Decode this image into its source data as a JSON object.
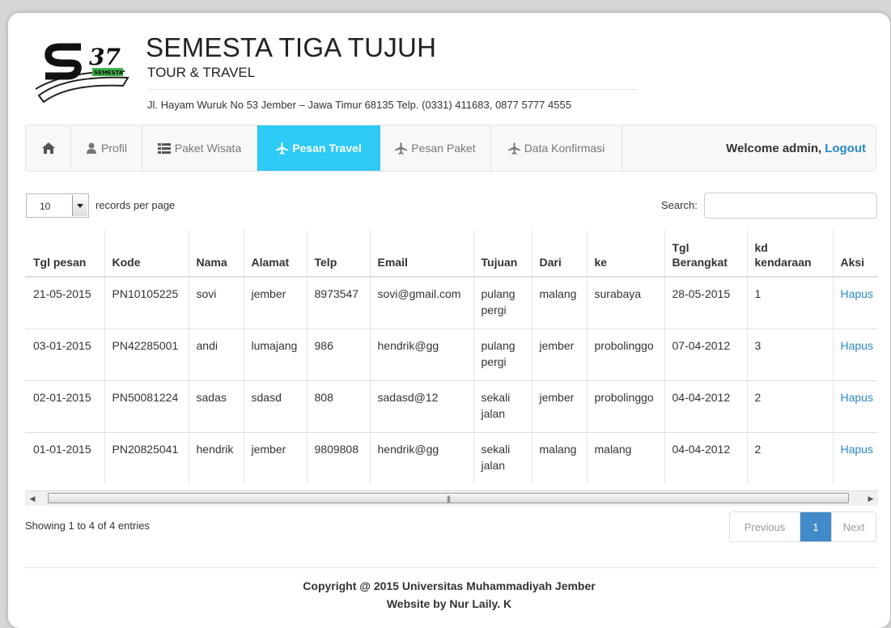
{
  "brand": {
    "title": "SEMESTA TIGA TUJUH",
    "subtitle": "TOUR & TRAVEL",
    "address": "Jl. Hayam Wuruk No 53 Jember – Jawa Timur 68135 Telp. (0331) 411683, 0877 5777 4555",
    "logo_text": "S37",
    "logo_small": "SEMESTA"
  },
  "nav": {
    "items": [
      {
        "label": "Profil",
        "icon": "user-icon"
      },
      {
        "label": "Paket Wisata",
        "icon": "list-icon"
      },
      {
        "label": "Pesan Travel",
        "icon": "plane-icon",
        "active": true
      },
      {
        "label": "Pesan Paket",
        "icon": "plane-icon"
      },
      {
        "label": "Data Konfirmasi",
        "icon": "plane-icon"
      }
    ],
    "welcome": "Welcome admin,",
    "logout": "Logout"
  },
  "controls": {
    "length_value": "10",
    "length_label": "records per page",
    "search_label": "Search:"
  },
  "table": {
    "headers": [
      "Tgl pesan",
      "Kode",
      "Nama",
      "Alamat",
      "Telp",
      "Email",
      "Tujuan",
      "Dari",
      "ke",
      "Tgl Berangkat",
      "kd kendaraan",
      "Aksi"
    ],
    "rows": [
      [
        "21-05-2015",
        "PN10105225",
        "sovi",
        "jember",
        "8973547",
        "sovi@gmail.com",
        "pulang pergi",
        "malang",
        "surabaya",
        "28-05-2015",
        "1",
        "Hapus"
      ],
      [
        "03-01-2015",
        "PN42285001",
        "andi",
        "lumajang",
        "986",
        "hendrik@gg",
        "pulang pergi",
        "jember",
        "probolinggo",
        "07-04-2012",
        "3",
        "Hapus"
      ],
      [
        "02-01-2015",
        "PN50081224",
        "sadas",
        "sdasd",
        "808",
        "sadasd@12",
        "sekali jalan",
        "jember",
        "probolinggo",
        "04-04-2012",
        "2",
        "Hapus"
      ],
      [
        "01-01-2015",
        "PN20825041",
        "hendrik",
        "jember",
        "9809808",
        "hendrik@gg",
        "sekali jalan",
        "malang",
        "malang",
        "04-04-2012",
        "2",
        "Hapus"
      ]
    ]
  },
  "info": "Showing 1 to 4 of 4 entries",
  "pagination": {
    "previous": "Previous",
    "current": "1",
    "next": "Next"
  },
  "footer": {
    "line1": "Copyright @ 2015 Universitas Muhammadiyah Jember",
    "line2": "Website by Nur Laily. K"
  },
  "colors": {
    "active_tab": "#2ccaf5",
    "link": "#2a8ac8",
    "page_active": "#428bca"
  }
}
